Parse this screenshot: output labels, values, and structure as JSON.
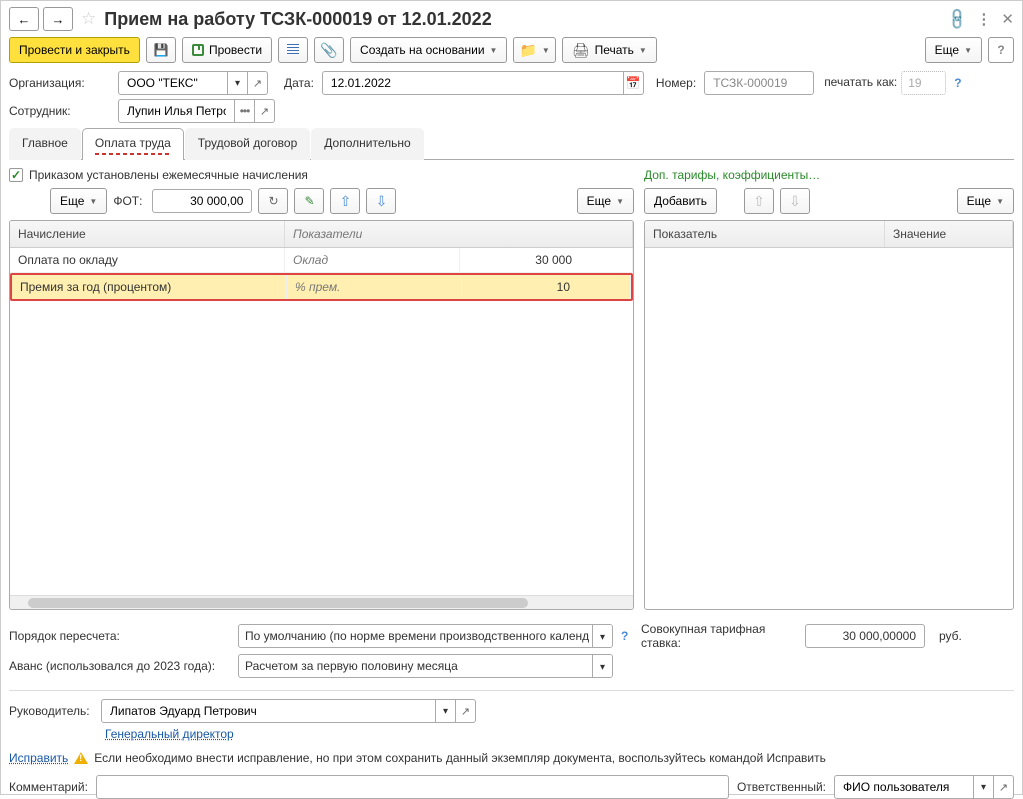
{
  "title": "Прием на работу ТСЗК-000019 от 12.01.2022",
  "toolbar": {
    "post_close": "Провести и закрыть",
    "post": "Провести",
    "create_based": "Создать на основании",
    "print": "Печать",
    "more": "Еще"
  },
  "form": {
    "org_label": "Организация:",
    "org_value": "ООО \"ТЕКС\"",
    "date_label": "Дата:",
    "date_value": "12.01.2022",
    "number_label": "Номер:",
    "number_value": "ТСЗК-000019",
    "print_as_label": "печатать как:",
    "print_as_value": "19",
    "employee_label": "Сотрудник:",
    "employee_value": "Лупин Илья Петрович"
  },
  "tabs": {
    "main": "Главное",
    "payment": "Оплата труда",
    "contract": "Трудовой договор",
    "additional": "Дополнительно"
  },
  "payment": {
    "checkbox": "Приказом установлены ежемесячные начисления",
    "more": "Еще",
    "fot_label": "ФОТ:",
    "fot_value": "30 000,00",
    "add": "Добавить",
    "addl_link": "Доп. тарифы, коэффициенты…",
    "grid": {
      "col_accrual": "Начисление",
      "col_indicators": "Показатели",
      "rows": [
        {
          "name": "Оплата по окладу",
          "ind": "Оклад",
          "val": "30 000"
        },
        {
          "name": "Премия за год (процентом)",
          "ind": "% прем.",
          "val": "10"
        }
      ]
    },
    "grid2": {
      "col_indicator": "Показатель",
      "col_value": "Значение"
    },
    "recalc_label": "Порядок пересчета:",
    "recalc_value": "По умолчанию (по норме времени производственного календ",
    "rate_label": "Совокупная тарифная ставка:",
    "rate_value": "30 000,00000",
    "rate_unit": "руб.",
    "advance_label": "Аванс (использовался до 2023 года):",
    "advance_value": "Расчетом за первую половину месяца"
  },
  "bottom": {
    "manager_label": "Руководитель:",
    "manager_value": "Липатов Эдуард Петрович",
    "manager_position": "Генеральный директор",
    "fix": "Исправить",
    "warn": "Если необходимо внести исправление, но при этом сохранить данный экземпляр документа, воспользуйтесь командой Исправить",
    "comment_label": "Комментарий:",
    "responsible_label": "Ответственный:",
    "responsible_value": "ФИО пользователя"
  }
}
